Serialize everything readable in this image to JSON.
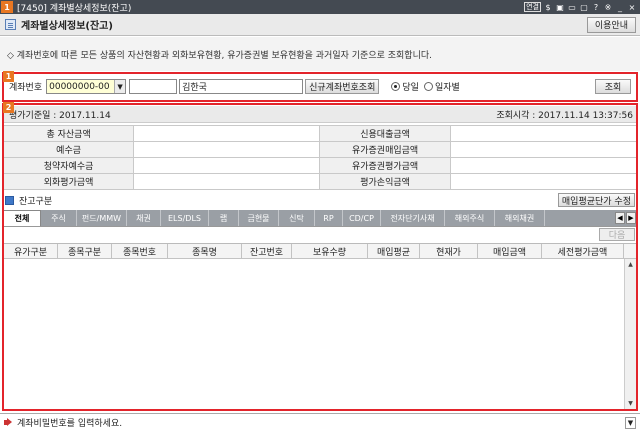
{
  "window": {
    "badge": "1",
    "title": "[7450] 계좌별상세정보(잔고)",
    "icons": [
      "연결",
      "$",
      "▣",
      "▭",
      "▢",
      "?",
      "※",
      "_",
      "×"
    ]
  },
  "header": {
    "title": "계좌별상세정보(잔고)",
    "guide_label": "이용안내"
  },
  "description": "◇ 계좌번호에 따른 모든 상품의 자산현황과 외화보유현황, 유가증권별 보유현황을 과거일자 기준으로 조회합니다.",
  "markers": {
    "search": "1",
    "results": "2"
  },
  "search": {
    "account_label": "계좌번호",
    "account_value": "00000000-00",
    "password_value": "",
    "name_value": "김한국",
    "new_account_label": "신규계좌번호조회",
    "radio_today": "당일",
    "radio_bydate": "일자별",
    "query_label": "조회"
  },
  "datebar": {
    "base_date": "평가기준일 : 2017.11.14",
    "query_time": "조회시각 : 2017.11.14 13:37:56"
  },
  "summary": {
    "rows": [
      {
        "l1": "총 자산금액",
        "v1": "",
        "l2": "신용대출금액",
        "v2": ""
      },
      {
        "l1": "예수금",
        "v1": "",
        "l2": "유가증권매입금액",
        "v2": ""
      },
      {
        "l1": "청약자예수금",
        "v1": "",
        "l2": "유가증권평가금액",
        "v2": ""
      },
      {
        "l1": "외화평가금액",
        "v1": "",
        "l2": "평가손익금액",
        "v2": ""
      }
    ]
  },
  "balance": {
    "title": "잔고구분",
    "modify_label": "매입평균단가 수정"
  },
  "tabs": [
    "전체",
    "주식",
    "펀드/MMW",
    "채권",
    "ELS/DLS",
    "랩",
    "금현물",
    "신탁",
    "RP",
    "CD/CP",
    "전자단기사채",
    "해외주식",
    "해외채권"
  ],
  "tabs_active": 0,
  "next_label": "다음",
  "grid": {
    "columns": [
      "유가구분",
      "종목구분",
      "종목번호",
      "종목명",
      "잔고번호",
      "보유수량",
      "매입평균",
      "현재가",
      "매입금액",
      "세전평가금액"
    ]
  },
  "status": {
    "message": "계좌비밀번호를 입력하세요."
  }
}
